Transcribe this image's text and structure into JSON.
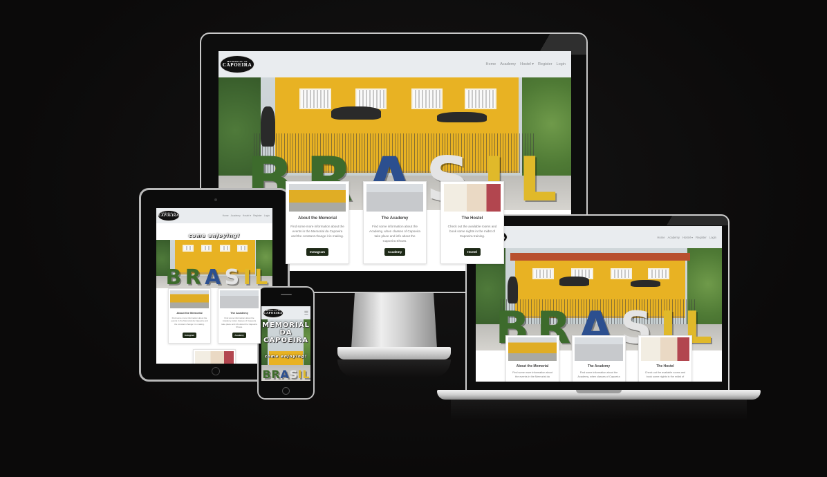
{
  "site": {
    "logo_line1": "MEMORIAL da",
    "logo_line2": "CAPOEIRA",
    "nav": [
      "Home",
      "Academy",
      "Hostel ▾",
      "Register",
      "Login"
    ],
    "hero_letters": [
      "B",
      "R",
      "A",
      "S",
      "I",
      "L"
    ],
    "hero_title": [
      "MEMORIAL",
      "DA",
      "CAPOEIRA"
    ],
    "hero_tagline": "come enjoying!",
    "cards": [
      {
        "title": "About the Memorial",
        "text": "Find some more information about the events in the Memorial da Capoeira and the constant change it is making.",
        "button": "Instagram"
      },
      {
        "title": "The Academy",
        "text": "Find some information about the Academy, when classes of Capoeira take place and info about the Capoeira Shows.",
        "button": "Academy"
      },
      {
        "title": "The Hostel",
        "text": "Check out the available rooms and book some nights in the midst of Capoeira training.",
        "button": "Hostel"
      }
    ],
    "letter_colors": [
      "#3d6b2c",
      "#3d6b2c",
      "#2c4f8f",
      "#dcdcdc",
      "#e0b92a",
      "#e0b92a"
    ]
  }
}
